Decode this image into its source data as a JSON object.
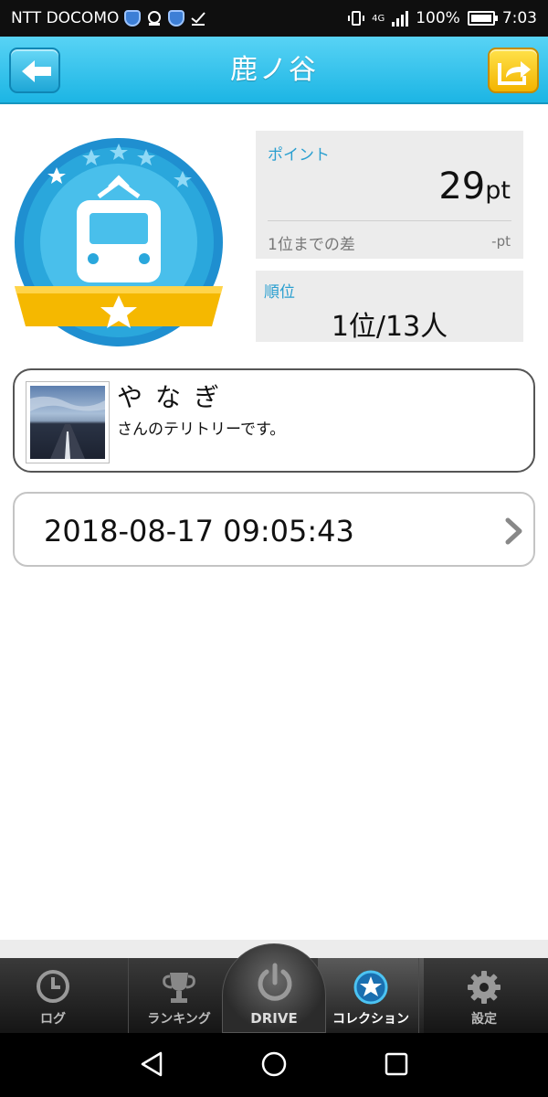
{
  "status_bar": {
    "carrier": "NTT DOCOMO",
    "network": "4G",
    "battery": "100%",
    "time": "7:03"
  },
  "header": {
    "title": "鹿ノ谷",
    "back_icon": "arrow-left-icon",
    "share_icon": "share-arrow-icon",
    "back_color": "#1ea6d6",
    "share_color": "#f3b400"
  },
  "badge": {
    "icon": "train-collection-badge",
    "ring_color": "#2aa7dc",
    "ribbon_color": "#f5b800"
  },
  "points": {
    "label": "ポイント",
    "value": "29",
    "unit": "pt",
    "diff_label": "1位までの差",
    "diff_value": "-pt"
  },
  "rank": {
    "label": "順位",
    "value": "1位/13人"
  },
  "territory": {
    "owner_name": "やなぎ",
    "message": "さんのテリトリーです。"
  },
  "history": {
    "datetime": "2018-08-17 09:05:43",
    "chevron_icon": "chevron-right-icon"
  },
  "tabs": [
    {
      "label": "ログ",
      "icon": "clock-icon"
    },
    {
      "label": "ランキング",
      "icon": "trophy-icon"
    },
    {
      "label": "DRIVE",
      "icon": "power-icon"
    },
    {
      "label": "コレクション",
      "icon": "star-circle-icon",
      "active": true
    },
    {
      "label": "設定",
      "icon": "gear-icon"
    }
  ],
  "nav": {
    "back": "back-triangle-icon",
    "home": "home-circle-icon",
    "recents": "recents-square-icon"
  }
}
